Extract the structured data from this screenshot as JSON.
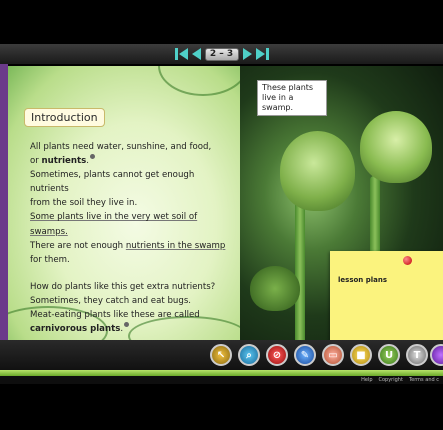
{
  "nav": {
    "page_indicator": "2 – 3"
  },
  "left_page": {
    "heading": "Introduction",
    "lines": {
      "l1": "All plants need water, sunshine, and food,",
      "l2_pre": "or ",
      "l2_bold": "nutrients",
      "l2_post": ".",
      "l3": "Sometimes, plants cannot get enough nutrients",
      "l4": "from the soil they live in.",
      "l5": "Some plants live in the very wet soil of swamps.",
      "l6_pre": "There are not enough ",
      "l6_link": "nutrients in the swamp",
      "l7": "for them.",
      "l8": "How do plants like this get extra nutrients?",
      "l9": "Sometimes, they catch and eat bugs.",
      "l10": "Meat-eating plants like these are called",
      "l11_bold": "carnivorous plants",
      "l11_post": "."
    }
  },
  "right_page": {
    "caption": "These plants live in a swamp.",
    "sticky_note": "lesson plans"
  },
  "toolbar": {
    "tools": [
      "pointer-tool",
      "search-tool",
      "stop-tool",
      "pen-tool",
      "eraser-tool",
      "highlighter-tool",
      "underline-tool",
      "text-tool",
      "extra-tool"
    ],
    "underline_letter": "U",
    "text_letter": "T"
  },
  "footer": {
    "links": [
      "Help",
      "Copyright",
      "Terms and c"
    ]
  },
  "colors": {
    "accent": "#4fd0c8",
    "frame": "#6b3a8a",
    "sticky": "#fbf37e"
  }
}
